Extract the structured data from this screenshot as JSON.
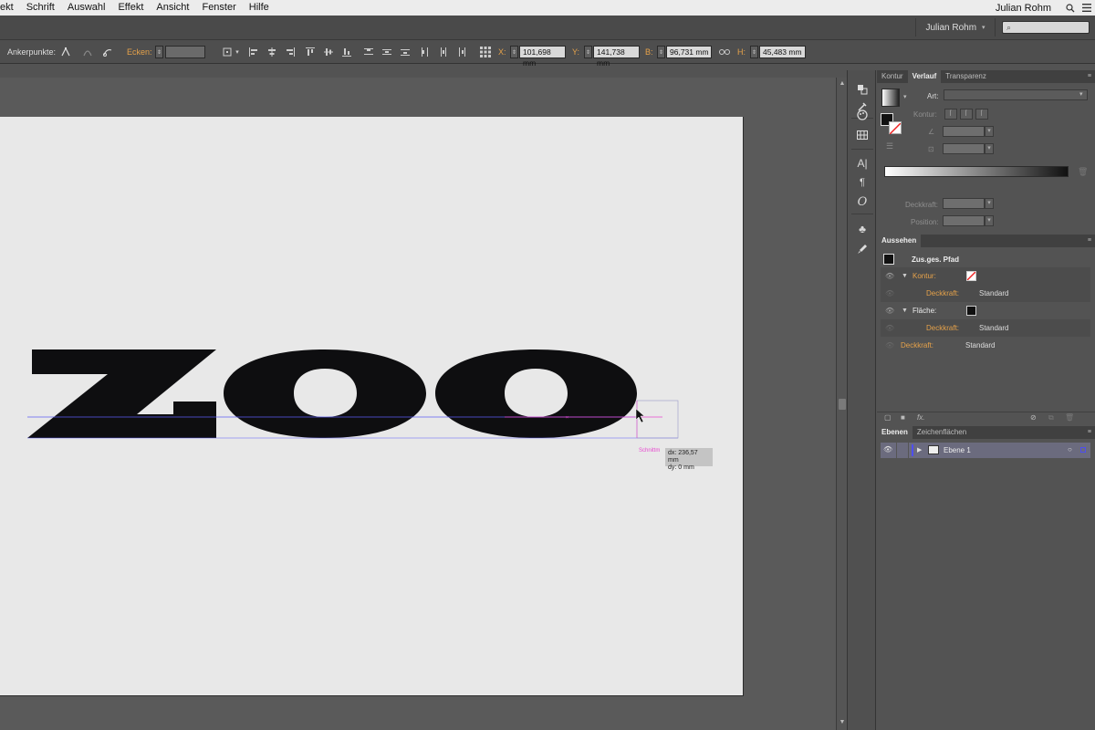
{
  "menubar": {
    "items": [
      "ekt",
      "Schrift",
      "Auswahl",
      "Effekt",
      "Ansicht",
      "Fenster",
      "Hilfe"
    ],
    "user": "Julian Rohm"
  },
  "appbar": {
    "workspace": "Julian Rohm",
    "search_placeholder": ""
  },
  "control": {
    "ankerpunkte_label": "Ankerpunkte:",
    "ecken_label": "Ecken:",
    "x_label": "X:",
    "x_value": "101,698 mm",
    "y_label": "Y:",
    "y_value": "141,738 mm",
    "b_label": "B:",
    "b_value": "96,731 mm",
    "h_label": "H:",
    "h_value": "45,483 mm"
  },
  "canvas": {
    "art_text": "ZOO",
    "smart_label": "Schnittm",
    "tooltip_dx": "dx: 236,57 mm",
    "tooltip_dy": "dy: 0 mm",
    "fill_color": "#0e0e10",
    "guide_color": "#5d5df5",
    "smartguide_color": "#e74ad0"
  },
  "verlauf_panel": {
    "tabs": [
      "Kontur",
      "Verlauf",
      "Transparenz"
    ],
    "active_tab": "Verlauf",
    "art_label": "Art:",
    "kontur_label": "Kontur:",
    "deckkraft_label": "Deckkraft:",
    "position_label": "Position:"
  },
  "aussehen_panel": {
    "tab": "Aussehen",
    "object": "Zus.ges. Pfad",
    "rows": [
      {
        "name": "Kontur:",
        "value": ""
      },
      {
        "name": "Deckkraft:",
        "value": "Standard"
      },
      {
        "name": "Fläche:",
        "value": ""
      },
      {
        "name": "Deckkraft:",
        "value": "Standard"
      },
      {
        "name": "Deckkraft:",
        "value": "Standard"
      }
    ],
    "fx_label": "fx."
  },
  "ebenen_panel": {
    "tabs": [
      "Ebenen",
      "Zeichenflächen"
    ],
    "layer": "Ebene 1"
  }
}
